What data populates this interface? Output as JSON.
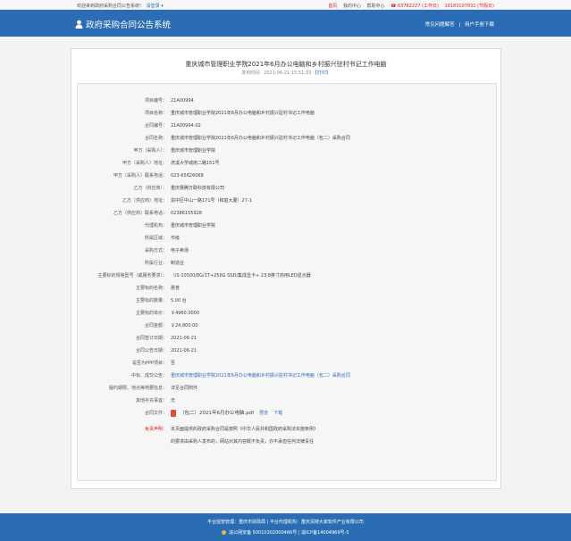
{
  "topbar": {
    "welcome": "欢迎来到政府采购合同公告系统!",
    "login": "请登录 ▾",
    "links": [
      "首页",
      "我的中心",
      "帮助中心"
    ],
    "phone1": "☎ 63782227 (工作日)",
    "phone2": "18183107831 (节假日)"
  },
  "header": {
    "system_title": "政府采购合同公告系统",
    "nav": [
      "常见问题解答",
      "|",
      "用户手册下载"
    ]
  },
  "notice": {
    "title": "重庆城市管理职业学院2021年6月办公电脑和乡村振兴驻村书记工作电脑",
    "publish_time": "发布时间：2021-06-21 15:51:33",
    "print": "【打印】"
  },
  "fields": [
    {
      "label": "项目编号：",
      "value": "21A00994"
    },
    {
      "label": "项目名称：",
      "value": "重庆城市管理职业学院2021年6月办公电脑和乡村振兴驻村书记工作电脑"
    },
    {
      "label": "合同编号：",
      "value": "21A00994-02"
    },
    {
      "label": "合同名称：",
      "value": "重庆城市管理职业学院2021年6月办公电脑和乡村振兴驻村书记工作电脑（包二）采购合同"
    },
    {
      "label": "甲方（采购人）：",
      "value": "重庆城市管理职业学院"
    },
    {
      "label": "甲方（采购人）地址：",
      "value": "虎溪大学城南二路151号"
    },
    {
      "label": "甲方（采购人）联系电话：",
      "value": "023-65626068"
    },
    {
      "label": "乙方（供应商）：",
      "value": "重庆赛腾方联科技有限公司"
    },
    {
      "label": "乙方（供应商）地址：",
      "value": "渝中区中山一路171号（和庭大厦）27-1"
    },
    {
      "label": "乙方（供应商）联系电话：",
      "value": "02386155928"
    },
    {
      "label": "代理机构：",
      "value": "重庆城市管理职业学院"
    },
    {
      "label": "所属区域：",
      "value": "市级"
    },
    {
      "label": "采购方式：",
      "value": "电子卖场"
    },
    {
      "label": "所属行业：",
      "value": "制造业"
    },
    {
      "label": "主要标的规格型号（或服务要求）：",
      "value": "（i5-10500/8G/1T+256G SSD/集成显卡+ 23.8英寸商用LED显示器"
    },
    {
      "label": "主要标的名称：",
      "value": "惠普"
    },
    {
      "label": "主要标的数量：",
      "value": "5.00 台"
    },
    {
      "label": "主要标的单价：",
      "value": "￥4960.0000"
    },
    {
      "label": "合同金额：",
      "value": "￥24,800.00"
    },
    {
      "label": "合同签订日期：",
      "value": "2021-06-21"
    },
    {
      "label": "合同公告日期：",
      "value": "2021-06-21"
    },
    {
      "label": "是否为PPP项目：",
      "value": "否"
    },
    {
      "label": "中标、成交公告：",
      "value": "重庆城市管理职业学院2021年6月办公电脑和乡村振兴驻村书记工作电脑（包二）采购合同",
      "link": true
    },
    {
      "label": "履约期限、地点等简要信息：",
      "value": "详见合同附件"
    },
    {
      "label": "其他补充事宜：",
      "value": "无"
    }
  ],
  "attachment": {
    "label": "合同文件：",
    "file_name": "（包二）2021年6月办公电脑.pdf",
    "preview": "预览",
    "download": "下载"
  },
  "disclaimer": {
    "label": "免责声明：",
    "line1": "本页面提供的政府采购合同是按照《中华人民共和国政府采购法实施条例》",
    "line2": "的要求由采购人发布的，网站对其内容概不负责，亦不承担任何法律责任"
  },
  "footer": {
    "line1": "平台监管管理：重庆市财政局  |  平台代理机构：重庆清搜大家软件产业有限公司",
    "police": "渝公网安备 50010302000466号",
    "icp": "| 渝ICP备14004969号-5"
  },
  "colors": {
    "brand": "#2a6db5",
    "link": "#2b6cb8",
    "alert": "#dd2222"
  }
}
